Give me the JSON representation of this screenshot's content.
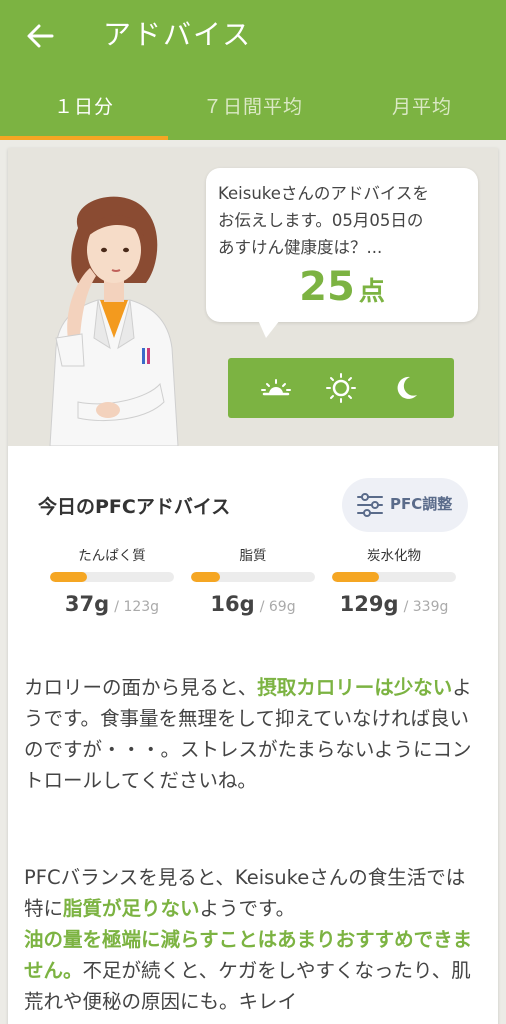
{
  "appbar": {
    "title": "アドバイス",
    "back_icon": "back-arrow-icon"
  },
  "tabs": [
    {
      "label": "１日分",
      "active": true
    },
    {
      "label": "７日間平均",
      "active": false
    },
    {
      "label": "月平均",
      "active": false
    }
  ],
  "advice": {
    "message": "Keisukeさんのアドバイスを\nお伝えします。05月05日の\nあすけん健康度は？...",
    "score": "25",
    "score_unit": "点",
    "time_icons": [
      "sunrise-icon",
      "sun-icon",
      "moon-icon"
    ]
  },
  "pfc": {
    "title": "今日のPFCアドバイス",
    "adjust_label": "PFC調整",
    "nutrients": [
      {
        "name": "たんぱく質",
        "value": "37g",
        "target": "/ 123g",
        "progress": 0.3
      },
      {
        "name": "脂質",
        "value": "16g",
        "target": "/ 69g",
        "progress": 0.23
      },
      {
        "name": "炭水化物",
        "value": "129g",
        "target": "/ 339g",
        "progress": 0.38
      }
    ]
  },
  "paragraphs": {
    "p1_a": "カロリーの面から見ると、",
    "p1_hl": "摂取カロリーは少ない",
    "p1_b": "ようです。食事量を無理をして抑えていなければ良いのですが・・・。ストレスがたまらないようにコントロールしてくださいね。",
    "p2_a": "PFCバランスを見ると、Keisukeさんの食生活では特に",
    "p2_hl1": "脂質が足りない",
    "p2_b": "ようです。",
    "p2_hl2": "油の量を極端に減らすことはあまりおすすめできません。",
    "p2_c": "不足が続くと、ケガをしやすくなったり、肌荒れや便秘の原因にも。キレイ"
  },
  "colors": {
    "primary": "#7cb342",
    "accent": "#f5a623",
    "hero_bg": "#e6e4dd"
  }
}
